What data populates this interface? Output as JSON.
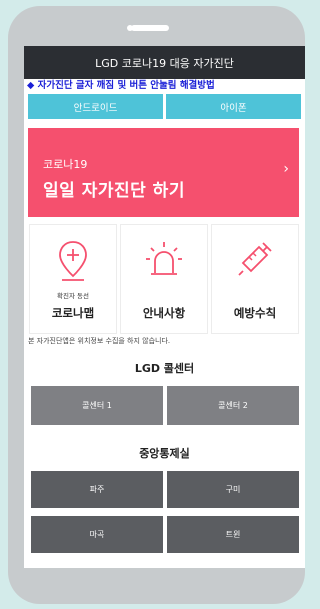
{
  "appbar": {
    "title": "LGD 코로나19 대응 자가진단"
  },
  "notice": {
    "text": "◆ 자가진단 글자 깨짐 및 버튼 안눌림 해결방법"
  },
  "os_buttons": {
    "android": "안드로이드",
    "iphone": "아이폰"
  },
  "hero": {
    "small": "코로나19",
    "big": "일일 자가진단 하기",
    "arrow": "›"
  },
  "tiles": [
    {
      "sub": "확진자 동선",
      "label": "코로나맵",
      "icon": "map-pin-plus-icon"
    },
    {
      "sub": "",
      "label": "안내사항",
      "icon": "siren-icon"
    },
    {
      "sub": "",
      "label": "예방수칙",
      "icon": "syringe-icon"
    }
  ],
  "privacy": "본 자가진단앱은 위치정보 수집을 하지 않습니다.",
  "callcenter": {
    "title": "LGD 콜센터",
    "buttons": [
      "콜센터 1",
      "콜센터 2"
    ]
  },
  "control": {
    "title": "중앙통제실",
    "buttons": [
      "파주",
      "구미",
      "마곡",
      "트윈"
    ]
  },
  "colors": {
    "appbar": "#2b2e33",
    "notice": "#1a1fd6",
    "os_button": "#4ec3d8",
    "hero": "#f5506e",
    "icon": "#f5506e",
    "gray_button": "#7f8084",
    "dark_button": "#5b5d61"
  }
}
